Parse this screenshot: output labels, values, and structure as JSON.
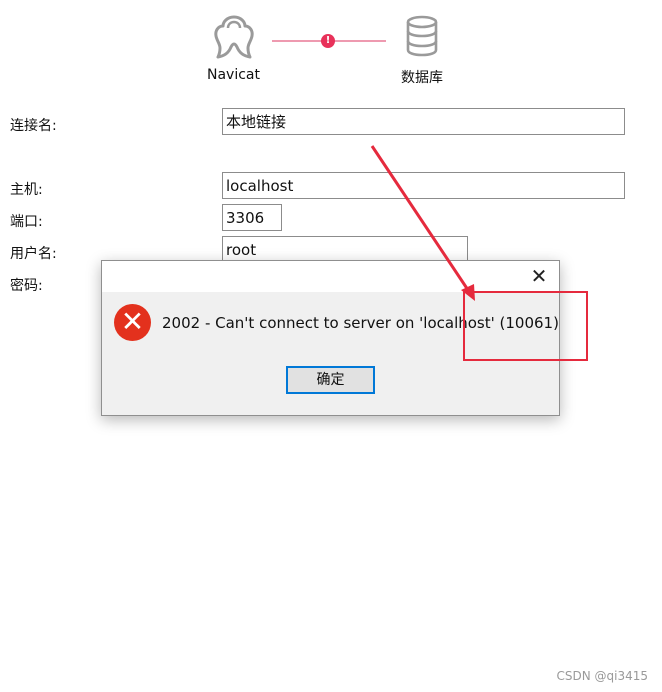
{
  "header": {
    "navicat_label": "Navicat",
    "database_label": "数据库",
    "status_symbol": "!",
    "navicat_icon": "navicat-logo-icon",
    "database_icon": "database-icon",
    "link_color": "#ee9ab0",
    "status_color": "#e8315a"
  },
  "form": {
    "connection_name_label": "连接名:",
    "connection_name_value": "本地链接",
    "host_label": "主机:",
    "host_value": "localhost",
    "port_label": "端口:",
    "port_value": "3306",
    "username_label": "用户名:",
    "username_value": "root",
    "password_label": "密码:"
  },
  "dialog": {
    "close_symbol": "✕",
    "error_symbol": "✕",
    "error_icon": "error-icon",
    "message": "2002 - Can't connect to server on 'localhost' (10061)",
    "ok_label": "确定",
    "error_color": "#e3311d",
    "accent_color": "#0078d7"
  },
  "annotation": {
    "color": "#e52a3d"
  },
  "watermark": "CSDN @qi3415"
}
